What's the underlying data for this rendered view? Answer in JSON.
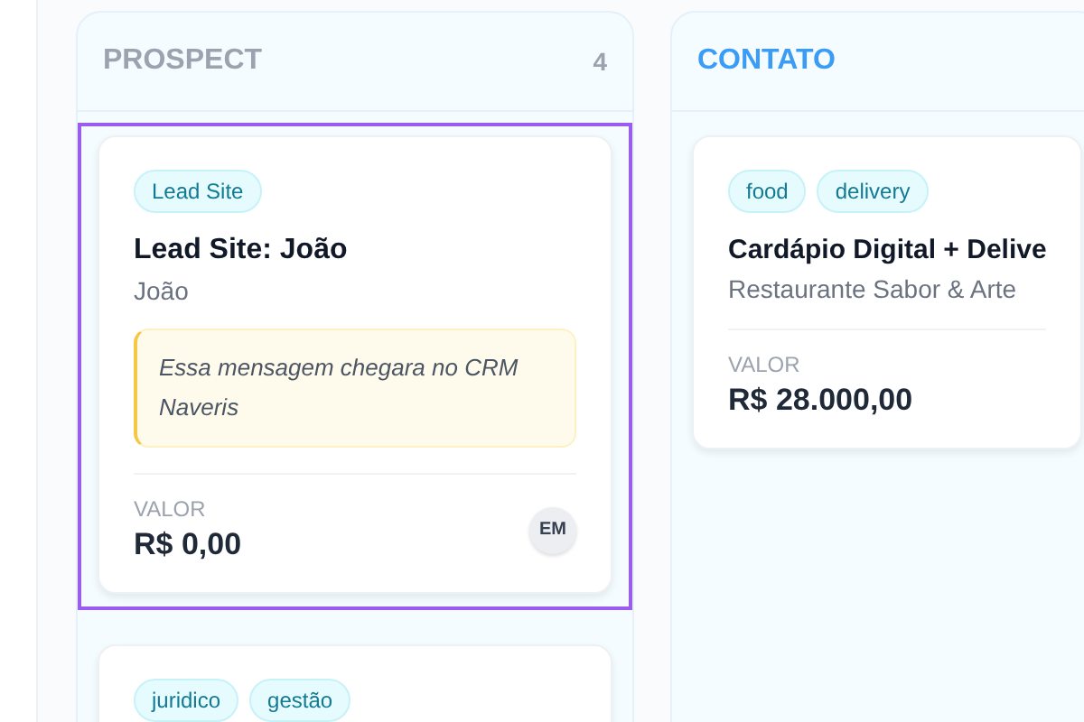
{
  "columns": [
    {
      "title": "PROSPECT",
      "count": "4",
      "color": "#9ca3af",
      "cards": [
        {
          "tags": [
            "Lead Site"
          ],
          "title": "Lead Site: João",
          "subtitle": "João",
          "message": "Essa mensagem chegara no CRM Naveris",
          "value_label": "VALOR",
          "value": "R$ 0,00",
          "avatar": "EM",
          "selected": true
        },
        {
          "tags": [
            "juridico",
            "gestão"
          ],
          "selected": false
        }
      ]
    },
    {
      "title": "CONTATO",
      "color": "#3b9cf5",
      "cards": [
        {
          "tags": [
            "food",
            "delivery"
          ],
          "title": "Cardápio Digital + Delive",
          "subtitle": "Restaurante Sabor & Arte",
          "value_label": "VALOR",
          "value": "R$ 28.000,00",
          "selected": false
        }
      ]
    }
  ]
}
